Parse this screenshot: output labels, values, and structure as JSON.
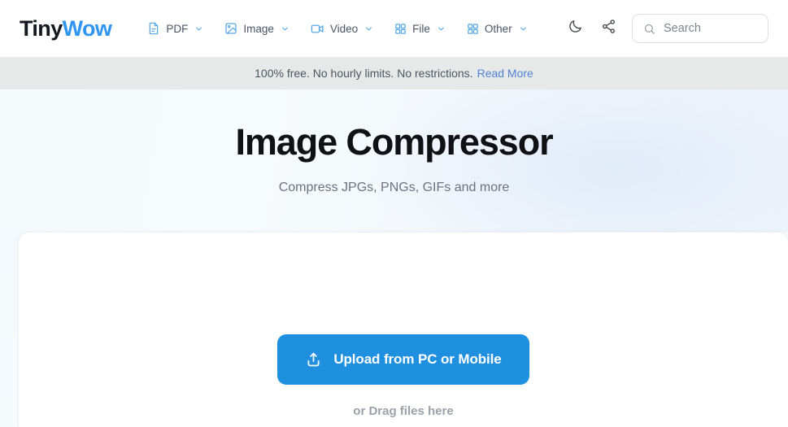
{
  "header": {
    "logo": {
      "part1": "Tiny",
      "part2": "Wow"
    },
    "nav": [
      {
        "label": "PDF",
        "icon": "document-icon"
      },
      {
        "label": "Image",
        "icon": "image-icon"
      },
      {
        "label": "Video",
        "icon": "video-camera-icon"
      },
      {
        "label": "File",
        "icon": "grid-icon"
      },
      {
        "label": "Other",
        "icon": "grid-icon"
      }
    ],
    "dark_mode_icon": "moon-icon",
    "share_icon": "share-icon",
    "search": {
      "placeholder": "Search",
      "value": "",
      "icon": "search-icon"
    }
  },
  "banner": {
    "text": "100% free. No hourly limits. No restrictions.",
    "link_label": "Read More"
  },
  "hero": {
    "title": "Image Compressor",
    "subtitle": "Compress JPGs, PNGs, GIFs and more"
  },
  "dropzone": {
    "upload_label": "Upload from PC or Mobile",
    "upload_icon": "upload-icon",
    "drag_text": "or Drag files here"
  },
  "colors": {
    "brand_blue": "#2f95f0",
    "button_blue": "#1f8fe0",
    "link_blue": "#4f83d6",
    "nav_icon_blue": "#5aa9e6",
    "banner_bg": "#e7e8e8",
    "text_dark": "#101114",
    "text_muted": "#6b7280"
  }
}
